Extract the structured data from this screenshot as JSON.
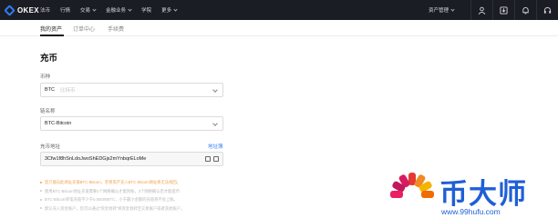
{
  "brand": {
    "name": "OKEX",
    "accent": "#2f7bf6"
  },
  "topnav": {
    "items": [
      {
        "label": "法币",
        "has_dropdown": false
      },
      {
        "label": "行情",
        "has_dropdown": false
      },
      {
        "label": "交易",
        "has_dropdown": true
      },
      {
        "label": "金融业务",
        "has_dropdown": true
      },
      {
        "label": "学院",
        "has_dropdown": false
      },
      {
        "label": "更多",
        "has_dropdown": true
      }
    ],
    "asset_management": "资产管理",
    "icons": [
      "user-icon",
      "download-icon",
      "bell-icon",
      "headset-icon"
    ]
  },
  "subnav": {
    "tabs": [
      "我的资产",
      "订单中心",
      "手续费"
    ],
    "active": "我的资产"
  },
  "page": {
    "title": "充币",
    "coin": {
      "label": "币种",
      "value": "BTC",
      "hint": "比特币"
    },
    "chain": {
      "label": "链名称",
      "value": "BTC-Bitcoin"
    },
    "address": {
      "label": "充币地址",
      "link": "地址簿",
      "value": "3Cfw1f8hSnLdoJwoShEDGjs2mYnbqrELoMe",
      "icons": [
        "copy-icon",
        "qrcode-icon"
      ]
    },
    "notes": [
      "您只能向此地址充值BTC-Bitcoin，若将资产充入BTC-Bitcoin地址将无法找回。",
      "使用BTC-Bitcoin地址充值需要1个网络确认才能到账，3个网络确认后才能提币",
      "BTC-Bitcoin单笔充值不少于0.00005BTC，小于最小金额的充值将不会上账。",
      "默认充入资金账户，您可以通过“资金划转”将资金划转至交易账户或者其他账户。"
    ],
    "warn_color": "#f0a04b"
  },
  "watermark": {
    "title": "币大师",
    "url": "www.99hufu.com",
    "color": "#1f5fd6"
  }
}
